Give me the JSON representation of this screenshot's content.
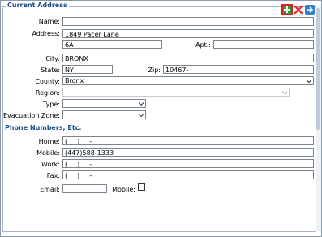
{
  "address": {
    "legend": "Current Address",
    "name_label": "Name:",
    "name_value": "",
    "address_label": "Address:",
    "address_line1": "1849 Pacer Lane",
    "address_line2": "6A",
    "apt_label": "Apt.:",
    "apt_value": "",
    "city_label": "City:",
    "city_value": "BRONX",
    "state_label": "State:",
    "state_value": "NY",
    "zip_label": "Zip:",
    "zip_value": "10467-____",
    "county_label": "County:",
    "county_value": "Bronx",
    "region_label": "Region:",
    "region_value": "",
    "type_label": "Type:",
    "type_value": "",
    "evac_label": "Evacuation Zone:",
    "evac_value": ""
  },
  "phones": {
    "title": "Phone Numbers, Etc.",
    "home_label": "Home:",
    "home_value": "(___)___-____",
    "mobile_label": "Mobile:",
    "mobile_value": "(447)588-1333",
    "work_label": "Work:",
    "work_value": "(___)___-____",
    "fax_label": "Fax:",
    "fax_value": "(___)___-____",
    "email_label": "Email:",
    "email_value": "",
    "mobile_check_label": "Mobile:"
  },
  "toolbar": {
    "icons": [
      "add-icon",
      "delete-icon",
      "forward-icon"
    ],
    "colors": {
      "add": "#2e9b2e",
      "delete": "#d93a2b",
      "forward": "#2f7fd0",
      "highlight": "#e02020"
    }
  },
  "colors": {
    "accent": "#1a4f8a",
    "border": "#7a8590"
  }
}
